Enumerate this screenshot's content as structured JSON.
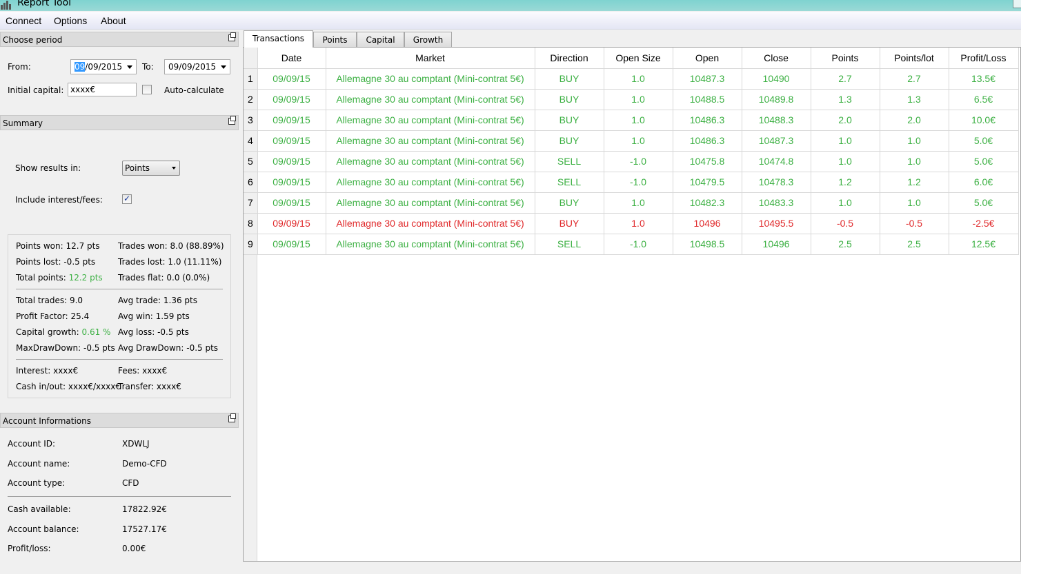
{
  "window": {
    "title": "Report Tool"
  },
  "menu": [
    "Connect",
    "Options",
    "About"
  ],
  "period": {
    "header": "Choose period",
    "from_label": "From:",
    "from_day_selected": "09",
    "from_rest": "/09/2015",
    "to_label": "To:",
    "to_value": "09/09/2015",
    "initial_capital_label": "Initial capital:",
    "initial_capital_value": "xxxx€",
    "auto_calculate_label": "Auto-calculate",
    "auto_calculate_checked": false
  },
  "summary": {
    "header": "Summary",
    "show_results_label": "Show results in:",
    "show_results_value": "Points",
    "include_fees_label": "Include interest/fees:",
    "include_fees_checked": true,
    "stats": {
      "points_won": "Points won: 12.7 pts",
      "points_lost": "Points lost: -0.5 pts",
      "total_points_label": "Total points: ",
      "total_points_value": "12.2 pts",
      "trades_won": "Trades won: 8.0 (88.89%)",
      "trades_lost": "Trades lost: 1.0 (11.11%)",
      "trades_flat": "Trades flat: 0.0 (0.0%)",
      "total_trades": "Total trades: 9.0",
      "profit_factor": "Profit Factor: 25.4",
      "capital_growth_label": "Capital growth: ",
      "capital_growth_value": "0.61 %",
      "max_drawdown": "MaxDrawDown: -0.5 pts",
      "avg_trade": "Avg trade: 1.36 pts",
      "avg_win": "Avg win: 1.59 pts",
      "avg_loss": "Avg loss: -0.5 pts",
      "avg_drawdown": "Avg DrawDown: -0.5 pts",
      "interest": "Interest: xxxx€",
      "cash_in_out": "Cash in/out: xxxx€/xxxx€",
      "fees": "Fees: xxxx€",
      "transfer": "Transfer: xxxx€"
    }
  },
  "account": {
    "header": "Account Informations",
    "id_label": "Account ID:",
    "id_value": "XDWLJ",
    "name_label": "Account name:",
    "name_value": "Demo-CFD",
    "type_label": "Account type:",
    "type_value": "CFD",
    "cash_label": "Cash available:",
    "cash_value": "17822.92€",
    "balance_label": "Account balance:",
    "balance_value": "17527.17€",
    "pl_label": "Profit/loss:",
    "pl_value": "0.00€"
  },
  "tabs": [
    "Transactions",
    "Points",
    "Capital",
    "Growth"
  ],
  "active_tab": "Transactions",
  "colors": {
    "win": "#3cb043",
    "loss": "#e0282a"
  },
  "table": {
    "columns": [
      "Date",
      "Market",
      "Direction",
      "Open Size",
      "Open",
      "Close",
      "Points",
      "Points/lot",
      "Profit/Loss"
    ],
    "rows": [
      {
        "n": "1",
        "status": "win",
        "cells": [
          "09/09/15",
          "Allemagne 30 au comptant (Mini-contrat 5€)",
          "BUY",
          "1.0",
          "10487.3",
          "10490",
          "2.7",
          "2.7",
          "13.5€"
        ]
      },
      {
        "n": "2",
        "status": "win",
        "cells": [
          "09/09/15",
          "Allemagne 30 au comptant (Mini-contrat 5€)",
          "BUY",
          "1.0",
          "10488.5",
          "10489.8",
          "1.3",
          "1.3",
          "6.5€"
        ]
      },
      {
        "n": "3",
        "status": "win",
        "cells": [
          "09/09/15",
          "Allemagne 30 au comptant (Mini-contrat 5€)",
          "BUY",
          "1.0",
          "10486.3",
          "10488.3",
          "2.0",
          "2.0",
          "10.0€"
        ]
      },
      {
        "n": "4",
        "status": "win",
        "cells": [
          "09/09/15",
          "Allemagne 30 au comptant (Mini-contrat 5€)",
          "BUY",
          "1.0",
          "10486.3",
          "10487.3",
          "1.0",
          "1.0",
          "5.0€"
        ]
      },
      {
        "n": "5",
        "status": "win",
        "cells": [
          "09/09/15",
          "Allemagne 30 au comptant (Mini-contrat 5€)",
          "SELL",
          "-1.0",
          "10475.8",
          "10474.8",
          "1.0",
          "1.0",
          "5.0€"
        ]
      },
      {
        "n": "6",
        "status": "win",
        "cells": [
          "09/09/15",
          "Allemagne 30 au comptant (Mini-contrat 5€)",
          "SELL",
          "-1.0",
          "10479.5",
          "10478.3",
          "1.2",
          "1.2",
          "6.0€"
        ]
      },
      {
        "n": "7",
        "status": "win",
        "cells": [
          "09/09/15",
          "Allemagne 30 au comptant (Mini-contrat 5€)",
          "BUY",
          "1.0",
          "10482.3",
          "10483.3",
          "1.0",
          "1.0",
          "5.0€"
        ]
      },
      {
        "n": "8",
        "status": "loss",
        "cells": [
          "09/09/15",
          "Allemagne 30 au comptant (Mini-contrat 5€)",
          "BUY",
          "1.0",
          "10496",
          "10495.5",
          "-0.5",
          "-0.5",
          "-2.5€"
        ]
      },
      {
        "n": "9",
        "status": "win",
        "cells": [
          "09/09/15",
          "Allemagne 30 au comptant (Mini-contrat 5€)",
          "SELL",
          "-1.0",
          "10498.5",
          "10496",
          "2.5",
          "2.5",
          "12.5€"
        ]
      }
    ]
  }
}
